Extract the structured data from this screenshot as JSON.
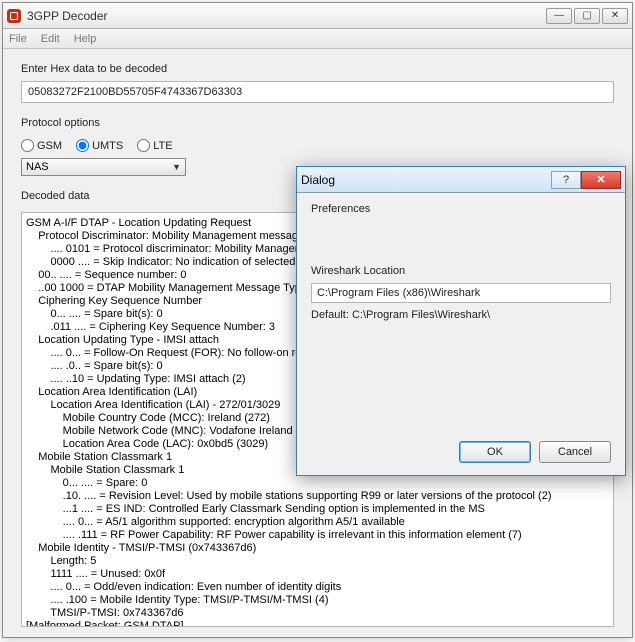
{
  "app": {
    "title": "3GPP Decoder",
    "menu": {
      "file": "File",
      "edit": "Edit",
      "help": "Help"
    },
    "win_controls": {
      "min": "—",
      "max": "▢",
      "close": "✕"
    }
  },
  "input": {
    "label": "Enter Hex data to be decoded",
    "value": "05083272F2100BD55705F4743367D63303"
  },
  "protocol": {
    "label": "Protocol options",
    "gsm": "GSM",
    "umts": "UMTS",
    "lte": "LTE",
    "selected": "UMTS",
    "dropdown": "NAS"
  },
  "decoded": {
    "label": "Decoded data",
    "text": "GSM A-I/F DTAP - Location Updating Request\n    Protocol Discriminator: Mobility Management messages (5)\n        .... 0101 = Protocol discriminator: Mobility Management m\n        0000 .... = Skip Indicator: No indication of selected PLMN (\n    00.. .... = Sequence number: 0\n    ..00 1000 = DTAP Mobility Management Message Type: Loca\n    Ciphering Key Sequence Number\n        0... .... = Spare bit(s): 0\n        .011 .... = Ciphering Key Sequence Number: 3\n    Location Updating Type - IMSI attach\n        .... 0... = Follow-On Request (FOR): No follow-on request\n        .... .0.. = Spare bit(s): 0\n        .... ..10 = Updating Type: IMSI attach (2)\n    Location Area Identification (LAI)\n        Location Area Identification (LAI) - 272/01/3029\n            Mobile Country Code (MCC): Ireland (272)\n            Mobile Network Code (MNC): Vodafone Ireland Plc (01)\n            Location Area Code (LAC): 0x0bd5 (3029)\n    Mobile Station Classmark 1\n        Mobile Station Classmark 1\n            0... .... = Spare: 0\n            .10. .... = Revision Level: Used by mobile stations supporting R99 or later versions of the protocol (2)\n            ...1 .... = ES IND: Controlled Early Classmark Sending option is implemented in the MS\n            .... 0... = A5/1 algorithm supported: encryption algorithm A5/1 available\n            .... .111 = RF Power Capability: RF Power capability is irrelevant in this information element (7)\n    Mobile Identity - TMSI/P-TMSI (0x743367d6)\n        Length: 5\n        1111 .... = Unused: 0x0f\n        .... 0... = Odd/even indication: Even number of identity digits\n        .... .100 = Mobile Identity Type: TMSI/P-TMSI/M-TMSI (4)\n        TMSI/P-TMSI: 0x743367d6\n[Malformed Packet: GSM DTAP]\n    [Expert Info (Error/Malformed): Malformed Packet (Exception occurred)]"
  },
  "dialog": {
    "title": "Dialog",
    "help": "?",
    "close": "✕",
    "heading": "Preferences",
    "loc_label": "Wireshark Location",
    "loc_value": "C:\\Program Files (x86)\\Wireshark",
    "loc_default": "Default: C:\\Program Files\\Wireshark\\",
    "ok": "OK",
    "cancel": "Cancel"
  }
}
